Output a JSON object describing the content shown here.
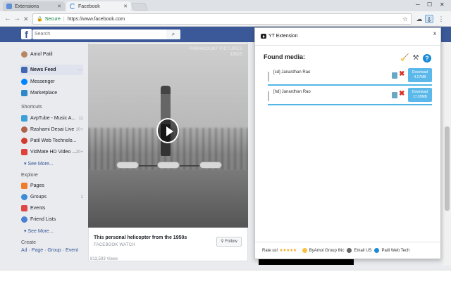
{
  "browser": {
    "tabs": [
      {
        "label": "Extensions"
      },
      {
        "label": "Facebook"
      }
    ],
    "address": {
      "secure_label": "Secure",
      "url": "https://www.facebook.com"
    }
  },
  "facebook": {
    "search_placeholder": "Search",
    "nav": {
      "profile": "Amol Patil",
      "news_feed": "News Feed",
      "messenger": "Messenger",
      "marketplace": "Marketplace",
      "shortcuts_heading": "Shortcuts",
      "shortcuts": [
        {
          "label": "AvpTube - Music A...",
          "count": "11"
        },
        {
          "label": "Rashami Desai Live",
          "count": "20+"
        },
        {
          "label": "Patil Web Technolo...",
          "count": ""
        },
        {
          "label": "VidMate HD Video ...",
          "count": "20+"
        }
      ],
      "see_more_1": "See More...",
      "explore_heading": "Explore",
      "explore": [
        {
          "label": "Pages",
          "count": ""
        },
        {
          "label": "Groups",
          "count": "1"
        },
        {
          "label": "Events",
          "count": ""
        },
        {
          "label": "Friend Lists",
          "count": ""
        }
      ],
      "see_more_2": "See More...",
      "create_heading": "Create",
      "create_links": "Ad · Page · Group · Event"
    },
    "post": {
      "watermark_1": "PARAMOUNT PICTURES",
      "watermark_2": "1950S",
      "title": "This personal helicopter from the 1950s",
      "subtitle": "FACEBOOK WATCH",
      "follow_label": "Follow",
      "views": "813,593 Views"
    }
  },
  "extension": {
    "title": "YT Extension",
    "close": "x",
    "found_label": "Found media:",
    "help": "?",
    "media": [
      {
        "label": "[sd] Janardhan Rao",
        "download_label": "Download",
        "size": "4.17MB"
      },
      {
        "label": "[hd] Janardhan Rao",
        "download_label": "Download",
        "size": "17.05MB"
      }
    ],
    "footer": {
      "rate": "Rate us!",
      "stars": "★★★★★",
      "by": "ByAmol Group INc",
      "email": "Email US",
      "site": "Patil Web Tech"
    }
  },
  "colors": {
    "fb_blue": "#3b5998",
    "download_blue": "#5ab9ea"
  }
}
